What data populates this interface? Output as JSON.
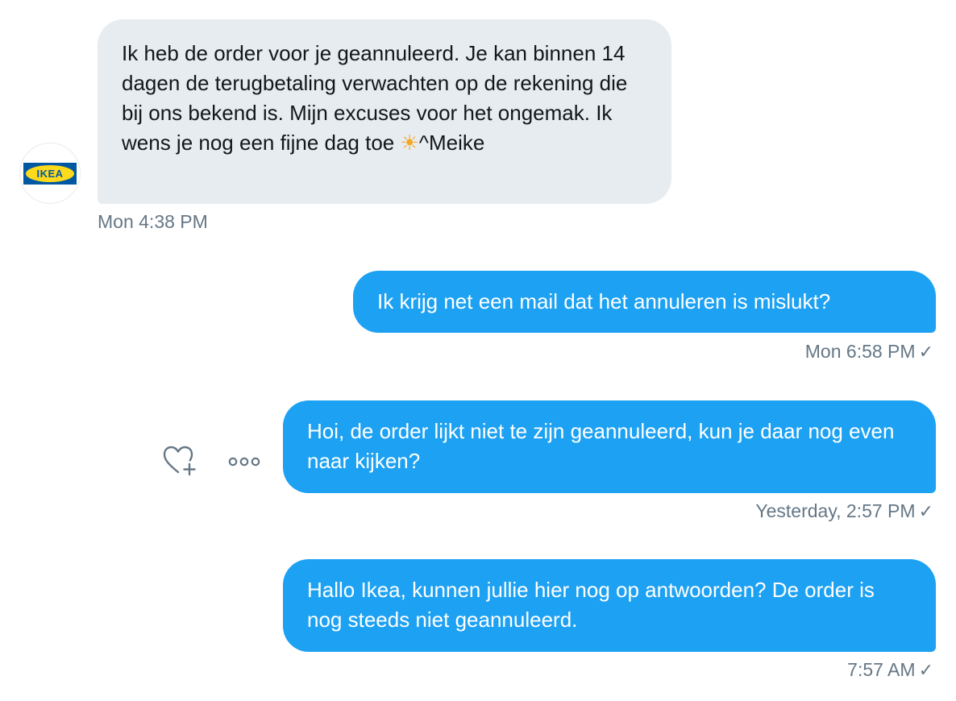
{
  "conversation": {
    "messages": [
      {
        "direction": "received",
        "sender": "IKEA",
        "text_before_emoji": "Ik heb de order voor je geannuleerd. Je kan binnen 14 dagen de terugbetaling verwachten op de rekening die bij ons bekend is. Mijn excuses voor het ongemak. Ik wens je nog een fijne dag toe ",
        "emoji": "☀",
        "text_after_emoji": "^Meike",
        "timestamp": "Mon 4:38 PM"
      },
      {
        "direction": "sent",
        "text": "Ik krijg net een mail dat het annuleren is mislukt?",
        "timestamp": "Mon 6:58 PM",
        "status_icon": "✓"
      },
      {
        "direction": "sent",
        "text": "Hoi, de order lijkt niet te zijn geannuleerd, kun je daar nog even naar kijken?",
        "timestamp": "Yesterday, 2:57 PM",
        "status_icon": "✓"
      },
      {
        "direction": "sent",
        "text": "Hallo Ikea, kunnen jullie hier nog op antwoorden? De order is nog steeds niet geannuleerd.",
        "timestamp": "7:57 AM",
        "status_icon": "✓"
      }
    ]
  },
  "avatar": {
    "logo_text": "IKEA",
    "icon": "ikea-logo-icon"
  },
  "actions": {
    "like_icon": "heart-plus-icon",
    "more_icon": "more-dots-icon"
  },
  "colors": {
    "sent_bubble": "#1da1f2",
    "received_bubble": "#e6ecf0",
    "timestamp": "#657786",
    "ikea_blue": "#0058a3",
    "ikea_yellow": "#ffda1a",
    "sun": "#f5a623"
  }
}
